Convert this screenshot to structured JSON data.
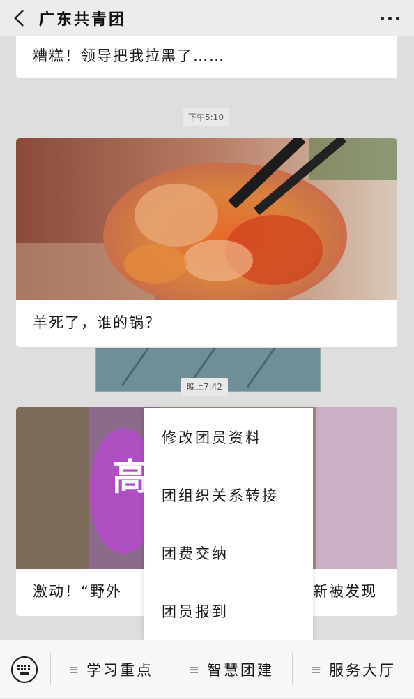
{
  "header": {
    "title": "广东共青团",
    "back_icon": "chevron-left-icon",
    "more_icon": "more-dots-icon"
  },
  "messages": [
    {
      "text": "糟糕！领导把我拉黑了……"
    },
    {
      "time": "下午5:10",
      "text": "羊死了，谁的锅？",
      "image": "lamb-meat-with-chopsticks"
    },
    {
      "time": "晚上7:42",
      "text_left": "激动！“野外",
      "text_right": "新被发现",
      "image_overlay_text": "高"
    }
  ],
  "popup_menu": {
    "items": [
      {
        "label": "修改团员资料"
      },
      {
        "label": "团组织关系转接"
      },
      {
        "label": "团费交纳"
      },
      {
        "label": "团员报到"
      }
    ]
  },
  "bottom_menu": {
    "keyboard_icon": "keyboard-icon",
    "tabs": [
      {
        "label": "学习重点"
      },
      {
        "label": "智慧团建"
      },
      {
        "label": "服务大厅"
      }
    ]
  },
  "colors": {
    "background": "#dedede",
    "header": "#ececec",
    "card": "#ffffff"
  }
}
